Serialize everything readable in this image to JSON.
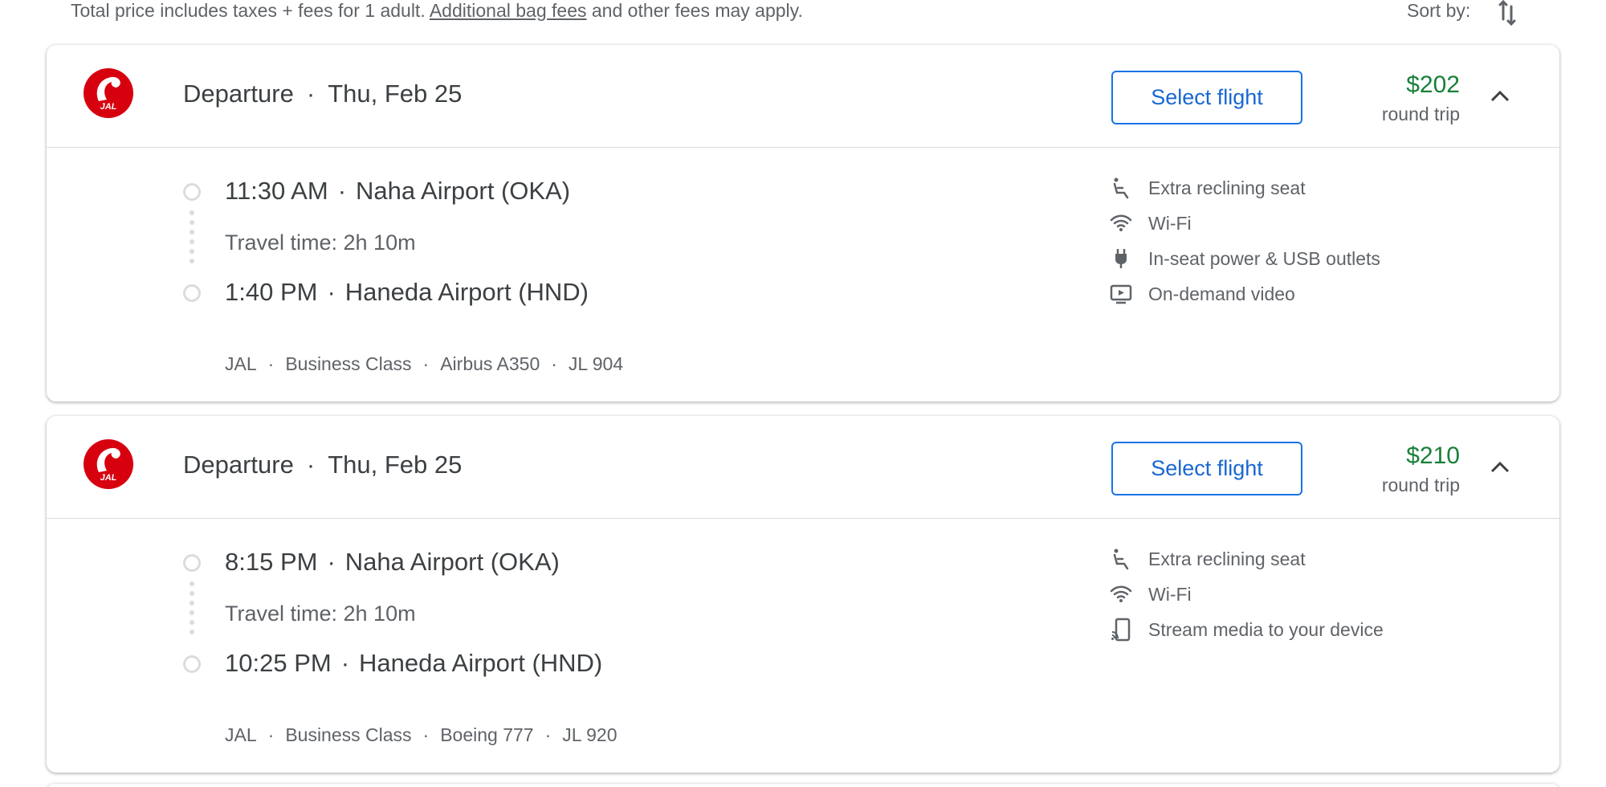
{
  "topbar": {
    "disclaimer_pre": "Total price includes taxes + fees for 1 adult.",
    "disclaimer_link": "Additional bag fees",
    "disclaimer_post": "and other fees may apply.",
    "sort_label": "Sort by:"
  },
  "flights": [
    {
      "header": {
        "label": "Departure",
        "sep": "·",
        "date": "Thu, Feb 25"
      },
      "select_label": "Select flight",
      "price": "$202",
      "price_sub": "round trip",
      "depart": {
        "time": "11:30 AM",
        "sep": "·",
        "airport": "Naha Airport (OKA)"
      },
      "travel": "Travel time: 2h 10m",
      "arrive": {
        "time": "1:40 PM",
        "sep": "·",
        "airport": "Haneda Airport (HND)"
      },
      "details": {
        "airline": "JAL",
        "class": "Business Class",
        "aircraft": "Airbus A350",
        "flight_no": "JL 904",
        "sep": "·"
      },
      "amenities": [
        {
          "icon": "reclining-seat-icon",
          "label": "Extra reclining seat"
        },
        {
          "icon": "wifi-icon",
          "label": "Wi-Fi"
        },
        {
          "icon": "power-plug-icon",
          "label": "In-seat power & USB outlets"
        },
        {
          "icon": "video-icon",
          "label": "On-demand video"
        }
      ]
    },
    {
      "header": {
        "label": "Departure",
        "sep": "·",
        "date": "Thu, Feb 25"
      },
      "select_label": "Select flight",
      "price": "$210",
      "price_sub": "round trip",
      "depart": {
        "time": "8:15 PM",
        "sep": "·",
        "airport": "Naha Airport (OKA)"
      },
      "travel": "Travel time: 2h 10m",
      "arrive": {
        "time": "10:25 PM",
        "sep": "·",
        "airport": "Haneda Airport (HND)"
      },
      "details": {
        "airline": "JAL",
        "class": "Business Class",
        "aircraft": "Boeing 777",
        "flight_no": "JL 920",
        "sep": "·"
      },
      "amenities": [
        {
          "icon": "reclining-seat-icon",
          "label": "Extra reclining seat"
        },
        {
          "icon": "wifi-icon",
          "label": "Wi-Fi"
        },
        {
          "icon": "stream-media-icon",
          "label": "Stream media to your device"
        }
      ]
    }
  ],
  "colors": {
    "price_green": "#188038",
    "accent_blue": "#1a73e8",
    "jal_red": "#d7000f"
  }
}
